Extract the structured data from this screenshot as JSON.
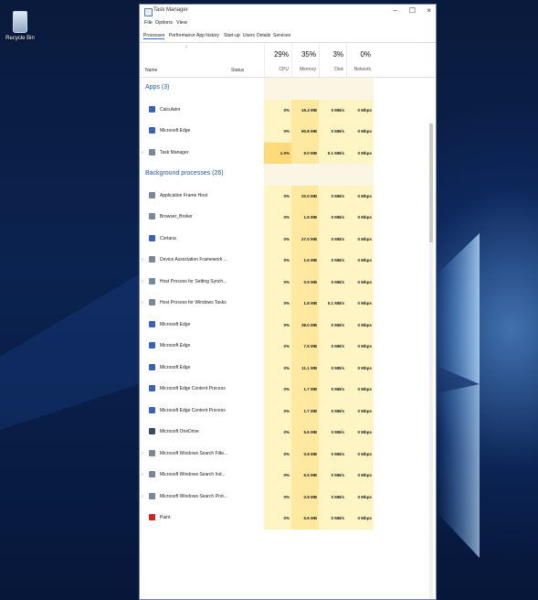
{
  "desktop": {
    "recycle_bin_label": "Recycle Bin",
    "recycle_bin_icon": "recycle-bin-icon"
  },
  "window": {
    "title": "Task Manager",
    "controls": {
      "minimize": "–",
      "maximize": "☐",
      "close": "×"
    }
  },
  "menu": [
    "File",
    "Options",
    "View"
  ],
  "tabs": [
    "Processes",
    "Performance",
    "App history",
    "Start-up",
    "Users",
    "Details",
    "Services"
  ],
  "active_tab": "Processes",
  "columns": {
    "name": "Name",
    "status": "Status",
    "cpu": {
      "pct": "29%",
      "label": "CPU"
    },
    "memory": {
      "pct": "35%",
      "label": "Memory"
    },
    "disk": {
      "pct": "3%",
      "label": "Disk"
    },
    "network": {
      "pct": "0%",
      "label": "Network"
    }
  },
  "groups": {
    "apps": "Apps (3)",
    "background": "Background processes (26)"
  },
  "apps": [
    {
      "name": "Calculator",
      "cpu": "0%",
      "mem": "15.4 MB",
      "disk": "0 MB/s",
      "net": "0 Mbps",
      "icon": "calculator-icon"
    },
    {
      "name": "Microsoft Edge",
      "cpu": "0%",
      "mem": "90.8 MB",
      "disk": "0 MB/s",
      "net": "0 Mbps",
      "icon": "edge-icon"
    },
    {
      "name": "Task Manager",
      "cpu": "1.0%",
      "mem": "9.0 MB",
      "disk": "0.1 MB/s",
      "net": "0 Mbps",
      "icon": "task-manager-icon"
    }
  ],
  "background": [
    {
      "name": "Application Frame Host",
      "cpu": "0%",
      "mem": "20.0 MB",
      "disk": "0 MB/s",
      "net": "0 Mbps",
      "icon": "app-frame-icon"
    },
    {
      "name": "Browser_Broker",
      "cpu": "0%",
      "mem": "1.6 MB",
      "disk": "0 MB/s",
      "net": "0 Mbps",
      "icon": "broker-icon"
    },
    {
      "name": "Cortana",
      "cpu": "0%",
      "mem": "27.0 MB",
      "disk": "0 MB/s",
      "net": "0 Mbps",
      "icon": "cortana-icon"
    },
    {
      "name": "Device Association Framework ...",
      "cpu": "0%",
      "mem": "1.6 MB",
      "disk": "0 MB/s",
      "net": "0 Mbps",
      "icon": "device-icon"
    },
    {
      "name": "Host Process for Setting Synch...",
      "cpu": "0%",
      "mem": "0.9 MB",
      "disk": "0 MB/s",
      "net": "0 Mbps",
      "icon": "host-process-icon"
    },
    {
      "name": "Host Process for Windows Tasks",
      "cpu": "0%",
      "mem": "1.8 MB",
      "disk": "0.1 MB/s",
      "net": "0 Mbps",
      "icon": "host-process-icon"
    },
    {
      "name": "Microsoft Edge",
      "cpu": "0%",
      "mem": "38.0 MB",
      "disk": "0 MB/s",
      "net": "0 Mbps",
      "icon": "edge-icon"
    },
    {
      "name": "Microsoft Edge",
      "cpu": "0%",
      "mem": "7.5 MB",
      "disk": "0 MB/s",
      "net": "0 Mbps",
      "icon": "edge-icon"
    },
    {
      "name": "Microsoft Edge",
      "cpu": "0%",
      "mem": "11.1 MB",
      "disk": "0 MB/s",
      "net": "0 Mbps",
      "icon": "edge-icon"
    },
    {
      "name": "Microsoft Edge Content Process",
      "cpu": "0%",
      "mem": "1.7 MB",
      "disk": "0 MB/s",
      "net": "0 Mbps",
      "icon": "edge-icon"
    },
    {
      "name": "Microsoft Edge Content Process",
      "cpu": "0%",
      "mem": "1.7 MB",
      "disk": "0 MB/s",
      "net": "0 Mbps",
      "icon": "edge-icon"
    },
    {
      "name": "Microsoft OneDrive",
      "cpu": "0%",
      "mem": "5.6 MB",
      "disk": "0 MB/s",
      "net": "0 Mbps",
      "icon": "onedrive-icon"
    },
    {
      "name": "Microsoft Windows Search Filte...",
      "cpu": "0%",
      "mem": "0.8 MB",
      "disk": "0 MB/s",
      "net": "0 Mbps",
      "icon": "search-filter-icon"
    },
    {
      "name": "Microsoft Windows Search Ind...",
      "cpu": "0%",
      "mem": "5.5 MB",
      "disk": "0 MB/s",
      "net": "0 Mbps",
      "icon": "search-indexer-icon"
    },
    {
      "name": "Microsoft Windows Search Prot...",
      "cpu": "0%",
      "mem": "0.9 MB",
      "disk": "0 MB/s",
      "net": "0 Mbps",
      "icon": "search-protocol-icon"
    },
    {
      "name": "Paint",
      "cpu": "0%",
      "mem": "5.6 MB",
      "disk": "0 MB/s",
      "net": "0 Mbps",
      "icon": "paint-icon"
    }
  ]
}
